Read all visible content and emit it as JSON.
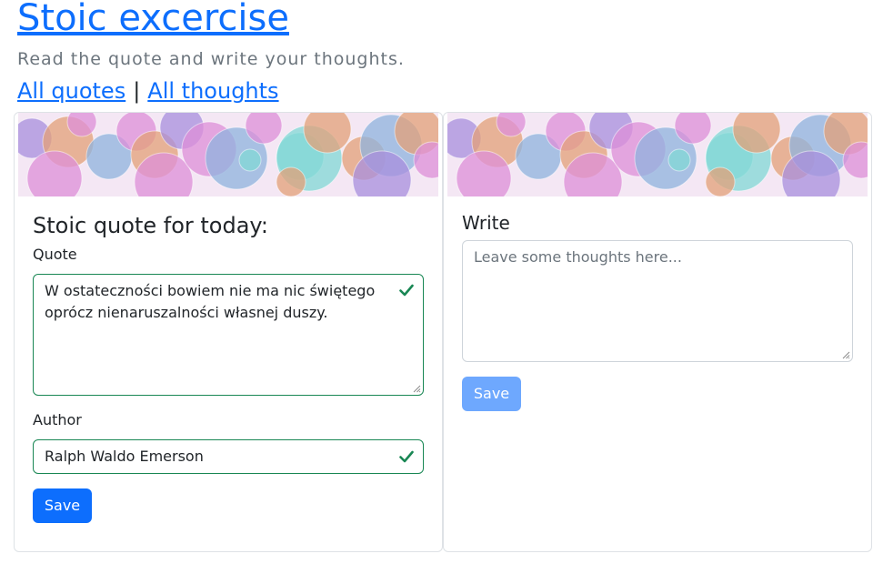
{
  "header": {
    "title": "Stoic excercise",
    "subtitle": "Read the quote and write your thoughts.",
    "nav": {
      "all_quotes": "All quotes",
      "separator": "|",
      "all_thoughts": "All thoughts"
    }
  },
  "quote_card": {
    "heading": "Stoic quote for today:",
    "quote_label": "Quote",
    "quote_value": "W ostateczności bowiem nie ma nic świętego oprócz nienaruszalności własnej duszy.",
    "author_label": "Author",
    "author_value": "Ralph Waldo Emerson",
    "save_label": "Save"
  },
  "thoughts_card": {
    "heading": "Write",
    "placeholder": "Leave some thoughts here...",
    "save_label": "Save"
  },
  "colors": {
    "link": "#0d6efd",
    "valid": "#198754",
    "button_disabled": "#6ea8fe",
    "bubble_pink": "#dd8fd8",
    "bubble_orange": "#e3a078",
    "bubble_blue": "#8fb3dd",
    "bubble_teal": "#82d8d6",
    "bubble_purple": "#a88fdd"
  }
}
